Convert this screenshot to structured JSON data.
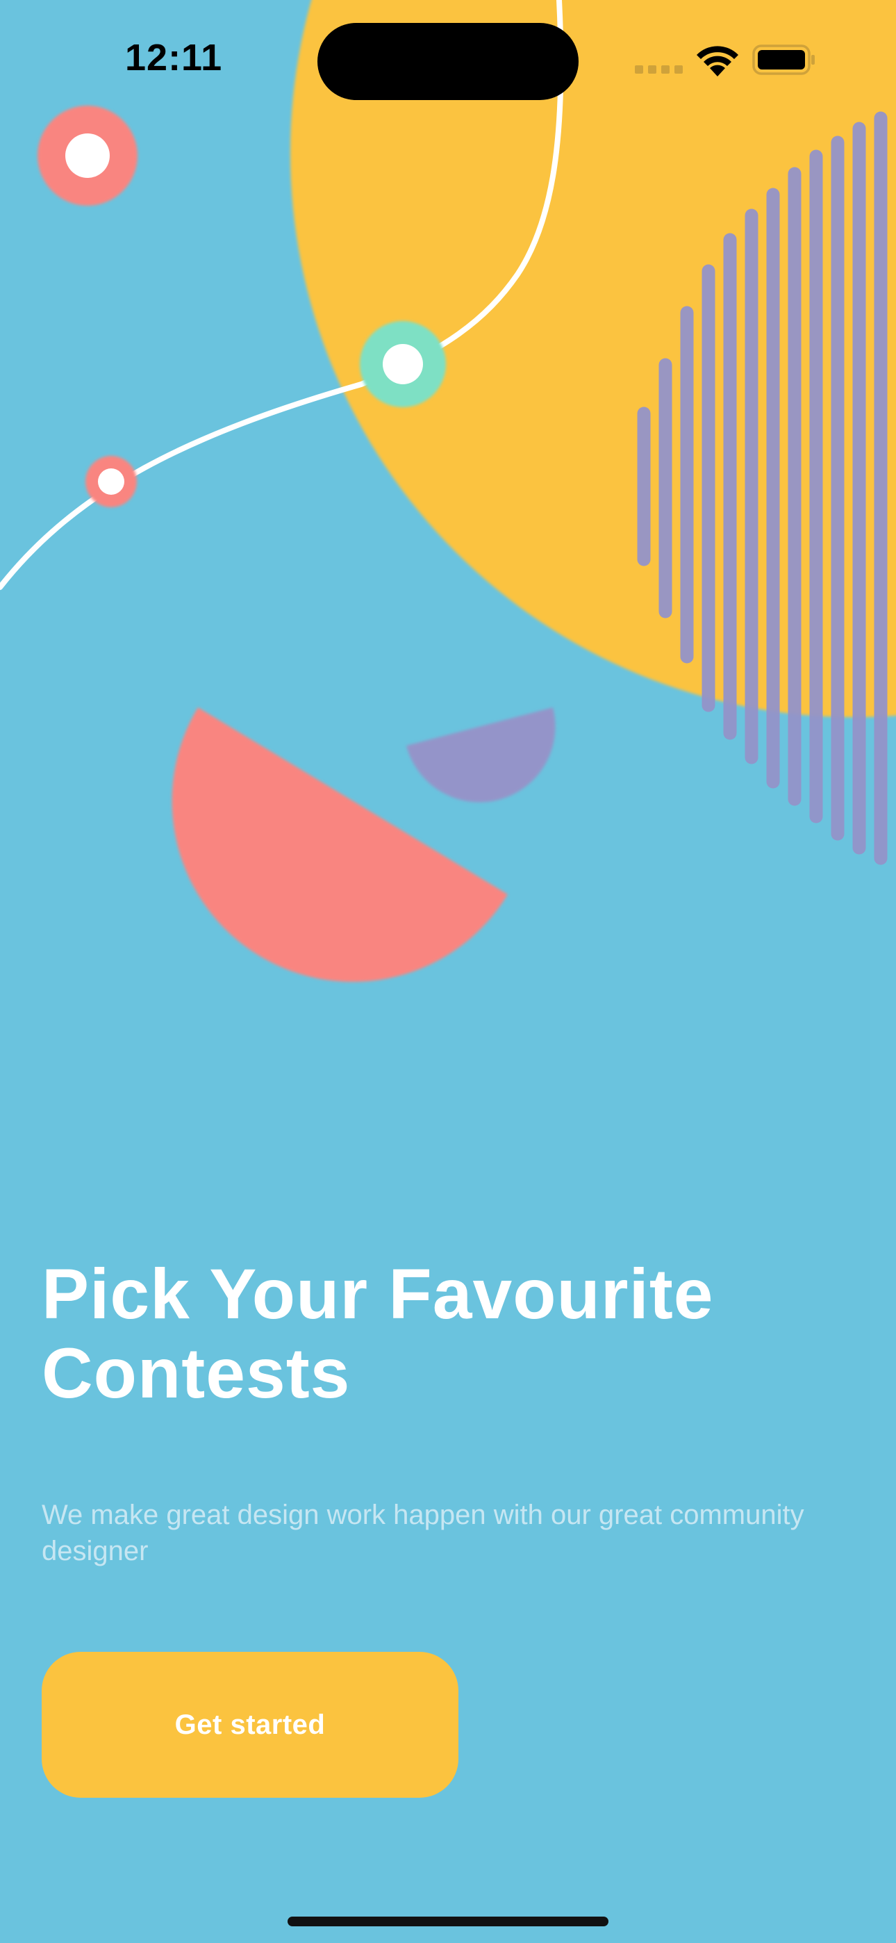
{
  "status_bar": {
    "time": "12:11"
  },
  "onboarding": {
    "title": "Pick Your Favourite Contests",
    "subtitle": "We make great design work happen with our great community designer",
    "cta_label": "Get started"
  },
  "colors": {
    "background": "#6ac3de",
    "accent_yellow": "#fbc33f",
    "coral": "#f98580",
    "lavender": "#9494c9",
    "mint": "#7ee0c4",
    "subtitle_text": "#c6e6f2"
  }
}
